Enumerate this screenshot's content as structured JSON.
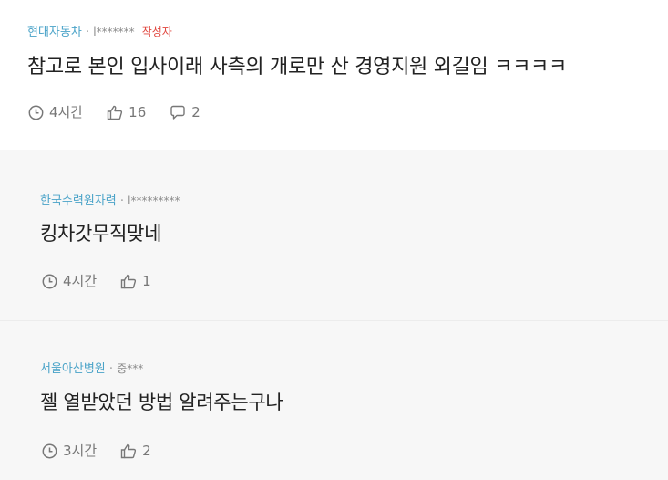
{
  "post": {
    "company": "현대자동차",
    "separator": "·",
    "nickname": "l*******",
    "author_badge": "작성자",
    "content": "참고로 본인 입사이래 사측의 개로만 산 경영지원 외길임 ㅋㅋㅋㅋ",
    "time": "4시간",
    "likes": "16",
    "comments": "2"
  },
  "replies": [
    {
      "company": "한국수력원자력",
      "separator": "·",
      "nickname": "l*********",
      "content": "킹차갓무직맞네",
      "time": "4시간",
      "likes": "1"
    },
    {
      "company": "서울아산병원",
      "separator": "·",
      "nickname": "중***",
      "content": "젤 열받았던 방법 알려주는구나",
      "time": "3시간",
      "likes": "2"
    }
  ],
  "icons": {
    "time": "clock-icon",
    "likes": "thumbs-up-icon",
    "comments": "speech-bubble-icon"
  },
  "colors": {
    "company": "#4aa3c8",
    "author_badge": "#e0453d",
    "reply_background": "#f7f7f7"
  }
}
